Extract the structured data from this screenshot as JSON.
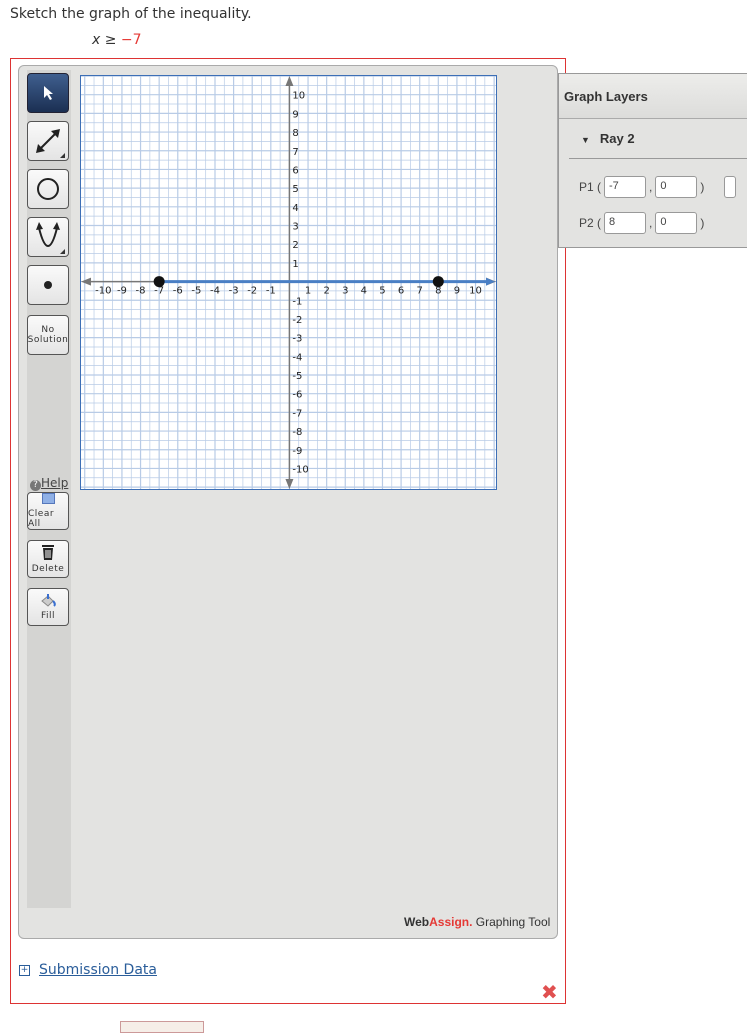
{
  "question": {
    "prompt": "Sketch the graph of the inequality.",
    "lhs": "x ≥ ",
    "rhs": "−7"
  },
  "toolbar": {
    "tools": [
      {
        "name": "select",
        "icon": "arrow-pointer-icon",
        "active": true
      },
      {
        "name": "ray",
        "icon": "double-arrow-line-icon"
      },
      {
        "name": "circle",
        "icon": "circle-icon"
      },
      {
        "name": "parabola",
        "icon": "parabola-icon"
      },
      {
        "name": "point",
        "icon": "point-icon"
      }
    ],
    "no_solution_line1": "No",
    "no_solution_line2": "Solution",
    "help": "Help",
    "clear_all": "Clear All",
    "delete": "Delete",
    "fill": "Fill"
  },
  "graph": {
    "x_range": [
      -11.2,
      11.1
    ],
    "y_range": [
      -11.1,
      11
    ],
    "x_ticks": [
      -10,
      -9,
      -8,
      -7,
      -6,
      -5,
      -4,
      -3,
      -2,
      -1,
      1,
      2,
      3,
      4,
      5,
      6,
      7,
      8,
      9,
      10
    ],
    "y_ticks": [
      10,
      9,
      8,
      7,
      6,
      5,
      4,
      3,
      2,
      1,
      -1,
      -2,
      -3,
      -4,
      -5,
      -6,
      -7,
      -8,
      -9,
      -10
    ],
    "ray": {
      "p1": [
        -7,
        0
      ],
      "p2": [
        8,
        0
      ],
      "color": "#4a7fc4"
    },
    "grid_color": "#b8cbe6"
  },
  "layers": {
    "title": "Graph Layers",
    "item": "Ray 2",
    "p1_label": "P1 (",
    "p2_label": "P2 (",
    "p1x": "-7",
    "p1y": "0",
    "p2x": "8",
    "p2y": "0",
    "comma": ",",
    "close": ")"
  },
  "brand": {
    "web": "Web",
    "assign": "Assign.",
    "rest": " Graphing Tool"
  },
  "submission": "Submission Data",
  "colors": {
    "error_border": "#dd3333",
    "accent_red": "#e53935",
    "link": "#2a5d9a"
  }
}
